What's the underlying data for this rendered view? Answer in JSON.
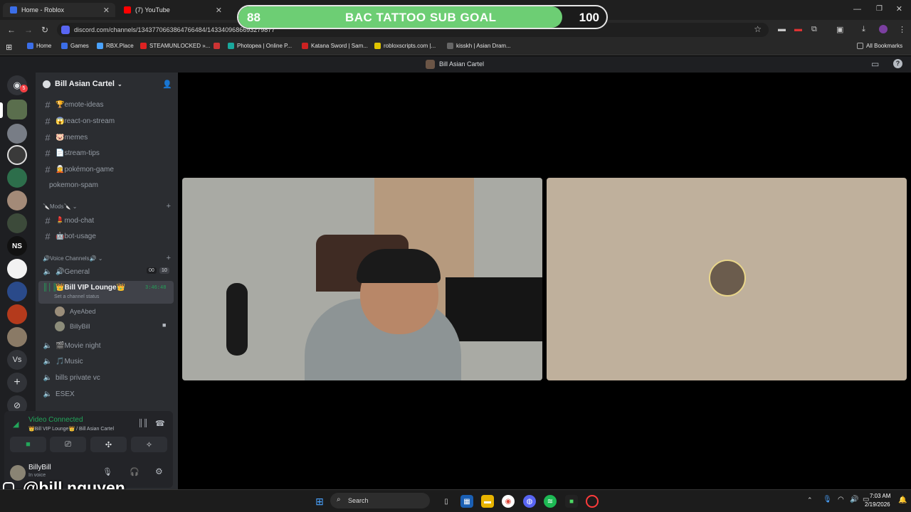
{
  "browser": {
    "tabs": [
      {
        "label": "Home - Roblox"
      },
      {
        "label": "(7) YouTube"
      }
    ],
    "url": "discord.com/channels/1343770663864766484/1433409686693279877",
    "bookmarks": [
      "Home",
      "Games",
      "RBX.Place",
      "STEAMUNLOCKED »...",
      "Photopea | Online P...",
      "Katana Sword | Sam...",
      "robloxscripts.com |...",
      "kisskh | Asian Dram..."
    ],
    "all_bookmarks": "All Bookmarks",
    "colors": {
      "chrome_bg": "#1f1f1f",
      "discord_sidebar": "#2b2d31"
    }
  },
  "goal_overlay": {
    "current": "88",
    "target": "100",
    "title": "BAC TATTOO SUB GOAL",
    "progress": 0.88,
    "color": "#6dce74"
  },
  "discord": {
    "window_title": "Bill Asian Cartel",
    "server_name": "Bill Asian Cartel",
    "home_badge": "5",
    "server_icons": [
      "NS",
      "Vs"
    ],
    "text_channels": [
      {
        "name": "🏆emote-ideas"
      },
      {
        "name": "😱react-on-stream"
      },
      {
        "name": "🐷memes"
      },
      {
        "name": "📄stream-tips"
      },
      {
        "name": "🧝pokémon-game"
      },
      {
        "name": "pokemon-spam"
      }
    ],
    "mods_category": "🔪Mods🔪",
    "mods_channels": [
      {
        "name": "💄mod-chat"
      },
      {
        "name": "🤖bot-usage"
      }
    ],
    "voice_category": "🔊Voice Channels🔊",
    "voice_channels": [
      {
        "name": "🔊General",
        "count_left": "00",
        "count_right": "10"
      },
      {
        "name": "👑Bill VIP Lounge👑",
        "timer": "3:46:48",
        "status": "Set a channel status"
      },
      {
        "name": "🎬Movie night"
      },
      {
        "name": "🎵Music"
      },
      {
        "name": "bills private vc"
      },
      {
        "name": "ESEX"
      }
    ],
    "voice_users": [
      "AyeAbed",
      "BillyBill"
    ],
    "connection": {
      "status": "Video Connected",
      "location": "👑Bill VIP Lounge👑 / Bill Asian Cartel"
    },
    "user": {
      "name": "BillyBill",
      "status": "In voice"
    }
  },
  "overlay_handle": "@bill.nguyen",
  "taskbar": {
    "search_placeholder": "Search",
    "time": "7:03 AM",
    "date": "2/19/2026"
  }
}
